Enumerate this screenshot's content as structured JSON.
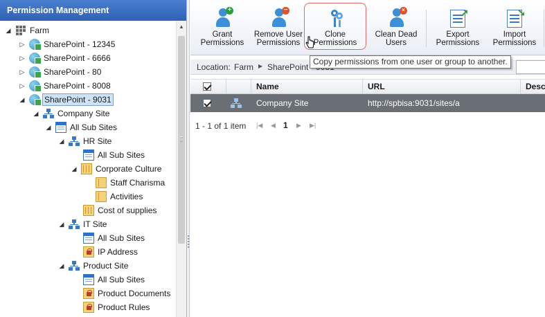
{
  "left_panel": {
    "title": "Permission Management",
    "tree": [
      {
        "label": "Farm",
        "icon": "farm-icon"
      },
      {
        "label": "SharePoint - 12345",
        "icon": "sharepoint-icon"
      },
      {
        "label": "SharePoint - 6666",
        "icon": "sharepoint-icon"
      },
      {
        "label": "SharePoint - 80",
        "icon": "sharepoint-icon"
      },
      {
        "label": "SharePoint - 8008",
        "icon": "sharepoint-icon"
      },
      {
        "label": "SharePoint - 9031",
        "icon": "sharepoint-icon",
        "selected": true
      },
      {
        "label": "Company Site",
        "icon": "site-icon"
      },
      {
        "label": "All Sub Sites",
        "icon": "subsites-icon"
      },
      {
        "label": "HR Site",
        "icon": "site-icon"
      },
      {
        "label": "All Sub Sites",
        "icon": "subsites-icon"
      },
      {
        "label": "Corporate Culture",
        "icon": "library-icon"
      },
      {
        "label": "Staff Charisma",
        "icon": "folder-icon"
      },
      {
        "label": "Activities",
        "icon": "folder-icon"
      },
      {
        "label": "Cost of supplies",
        "icon": "library-icon"
      },
      {
        "label": "IT Site",
        "icon": "site-icon"
      },
      {
        "label": "All Sub Sites",
        "icon": "subsites-icon"
      },
      {
        "label": "IP Address",
        "icon": "locked-list-icon"
      },
      {
        "label": "Product Site",
        "icon": "site-icon"
      },
      {
        "label": "All Sub Sites",
        "icon": "subsites-icon"
      },
      {
        "label": "Product Documents",
        "icon": "locked-list-icon"
      },
      {
        "label": "Product Rules",
        "icon": "locked-list-icon"
      }
    ]
  },
  "ribbon": {
    "grant": {
      "line1": "Grant",
      "line2": "Permissions"
    },
    "remove": {
      "line1": "Remove User",
      "line2": "Permissions"
    },
    "clone": {
      "line1": "Clone",
      "line2": "Permissions"
    },
    "clean": {
      "line1": "Clean Dead",
      "line2": "Users"
    },
    "export": {
      "line1": "Export",
      "line2": "Permissions"
    },
    "import": {
      "line1": "Import",
      "line2": "Permissions"
    }
  },
  "tooltip": "Copy permissions from one user or group to another.",
  "address": {
    "label": "Location:",
    "crumbs": [
      "Farm",
      "SharePoint - 9031"
    ]
  },
  "grid": {
    "columns": [
      "Name",
      "URL",
      "Description"
    ],
    "rows": [
      {
        "name": "Company Site",
        "url": "http://spbisa:9031/sites/a",
        "checked": true
      }
    ]
  },
  "pager": {
    "info": "1 - 1 of 1 item",
    "current_page": "1"
  }
}
